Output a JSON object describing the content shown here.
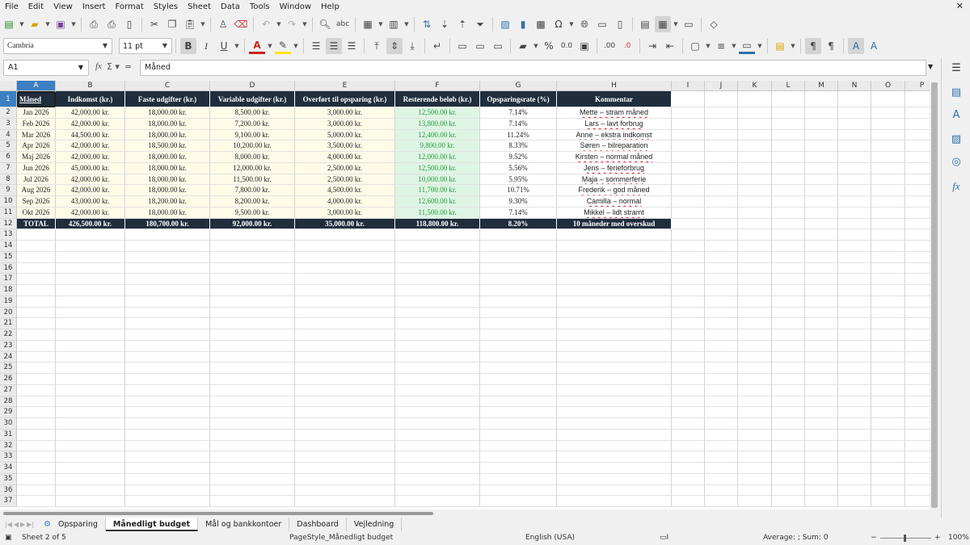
{
  "menu": [
    "File",
    "Edit",
    "View",
    "Insert",
    "Format",
    "Styles",
    "Sheet",
    "Data",
    "Tools",
    "Window",
    "Help"
  ],
  "font": {
    "name": "Cambria",
    "size": "11 pt"
  },
  "formula_bar": {
    "cell_ref": "A1",
    "content": "Måned"
  },
  "columns": [
    "A",
    "B",
    "C",
    "D",
    "E",
    "F",
    "G",
    "H",
    "I",
    "J",
    "K",
    "L",
    "M",
    "N",
    "O",
    "P"
  ],
  "rows": [
    "1",
    "2",
    "3",
    "4",
    "5",
    "6",
    "7",
    "8",
    "9",
    "10",
    "11",
    "12",
    "13",
    "14",
    "15",
    "16",
    "17",
    "18",
    "19",
    "20",
    "21",
    "22",
    "23",
    "24",
    "25",
    "26",
    "27",
    "28",
    "29",
    "30",
    "31",
    "32",
    "33",
    "34",
    "35",
    "36",
    "37"
  ],
  "table": {
    "headers": [
      "Måned",
      "Indkomst (kr.)",
      "Faste udgifter (kr.)",
      "Variable udgifter (kr.)",
      "Overført til opsparing (kr.)",
      "Resterende beløb (kr.)",
      "Opsparingsrate (%)",
      "Kommentar"
    ],
    "rows": [
      [
        "Jan 2026",
        "42,000.00 kr.",
        "18,000.00 kr.",
        "8,500.00 kr.",
        "3,000.00 kr.",
        "12,500.00 kr.",
        "7.14%",
        "Mette – stram måned"
      ],
      [
        "Feb 2026",
        "42,000.00 kr.",
        "18,000.00 kr.",
        "7,200.00 kr.",
        "3,000.00 kr.",
        "13,800.00 kr.",
        "7.14%",
        "Lars – lavt forbrug"
      ],
      [
        "Mar 2026",
        "44,500.00 kr.",
        "18,000.00 kr.",
        "9,100.00 kr.",
        "5,000.00 kr.",
        "12,400.00 kr.",
        "11.24%",
        "Anne – ekstra indkomst"
      ],
      [
        "Apr 2026",
        "42,000.00 kr.",
        "18,500.00 kr.",
        "10,200.00 kr.",
        "3,500.00 kr.",
        "9,800.00 kr.",
        "8.33%",
        "Søren – bilreparation"
      ],
      [
        "Maj 2026",
        "42,000.00 kr.",
        "18,000.00 kr.",
        "8,000.00 kr.",
        "4,000.00 kr.",
        "12,000.00 kr.",
        "9.52%",
        "Kirsten – normal måned"
      ],
      [
        "Jun 2026",
        "45,000.00 kr.",
        "18,000.00 kr.",
        "12,000.00 kr.",
        "2,500.00 kr.",
        "12,500.00 kr.",
        "5.56%",
        "Jens – ferieforbrug"
      ],
      [
        "Jul 2026",
        "42,000.00 kr.",
        "18,000.00 kr.",
        "11,500.00 kr.",
        "2,500.00 kr.",
        "10,000.00 kr.",
        "5.95%",
        "Maja – sommerferie"
      ],
      [
        "Aug 2026",
        "42,000.00 kr.",
        "18,000.00 kr.",
        "7,800.00 kr.",
        "4,500.00 kr.",
        "11,700.00 kr.",
        "10.71%",
        "Frederik – god måned"
      ],
      [
        "Sep 2026",
        "43,000.00 kr.",
        "18,200.00 kr.",
        "8,200.00 kr.",
        "4,000.00 kr.",
        "12,600.00 kr.",
        "9.30%",
        "Camilla – normal"
      ],
      [
        "Okt 2026",
        "42,000.00 kr.",
        "18,000.00 kr.",
        "9,500.00 kr.",
        "3,000.00 kr.",
        "11,500.00 kr.",
        "7.14%",
        "Mikkel – lidt stramt"
      ]
    ],
    "total": [
      "TOTAL",
      "426,500.00 kr.",
      "180,700.00 kr.",
      "92,000.00 kr.",
      "35,000.00 kr.",
      "118,800.00 kr.",
      "8.20%",
      "10 måneder med overskud"
    ]
  },
  "sheet_tabs": [
    "Opsparing",
    "Månedligt budget",
    "Mål og bankkontoer",
    "Dashboard",
    "Vejledning"
  ],
  "active_tab": "Månedligt budget",
  "status": {
    "sheet": "Sheet 2 of 5",
    "page_style": "PageStyle_Månedligt budget",
    "language": "English (USA)",
    "summary": "Average: ; Sum: 0",
    "zoom": "100%"
  },
  "colors": {
    "header_bg": "#1f2d3d",
    "cream": "#fffbe8",
    "green_bg": "#dff5e4",
    "green_text": "#1e9e3a",
    "selection": "#3c7fc2"
  }
}
